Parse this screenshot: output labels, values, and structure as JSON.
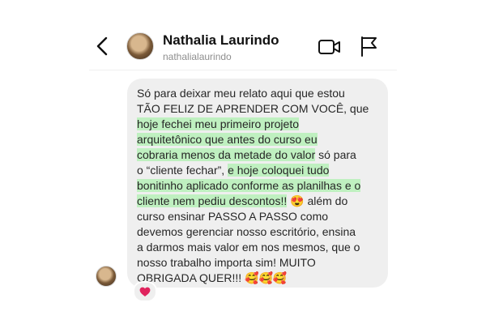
{
  "header": {
    "name": "Nathalia Laurindo",
    "username": "nathalialaurindo"
  },
  "icons": {
    "back": "chevron-left-icon",
    "video": "video-camera-icon",
    "flag": "flag-icon",
    "reaction": "heart-icon"
  },
  "colors": {
    "highlight": "#bff0c0",
    "bubble": "#efefef",
    "heart": "#e0245e"
  },
  "message": {
    "lines": [
      {
        "segments": [
          {
            "text": "Só para deixar meu relato aqui que estou"
          }
        ]
      },
      {
        "segments": [
          {
            "text": "TÃO FELIZ DE APRENDER COM VOCÊ, que"
          }
        ]
      },
      {
        "segments": [
          {
            "text": "hoje fechei meu primeiro projeto",
            "hl": true
          }
        ]
      },
      {
        "segments": [
          {
            "text": "arquitetônico que antes do curso eu",
            "hl": true
          }
        ]
      },
      {
        "segments": [
          {
            "text": "cobraria menos da metade do valor",
            "hl": true
          },
          {
            "text": " só para"
          }
        ]
      },
      {
        "segments": [
          {
            "text": "o “cliente fechar”, "
          },
          {
            "text": "e hoje coloquei tudo",
            "hl": true
          }
        ]
      },
      {
        "segments": [
          {
            "text": "bonitinho aplicado conforme as planilhas e o",
            "hl": true
          }
        ]
      },
      {
        "segments": [
          {
            "text": "cliente nem pediu descontos!!",
            "hl": true
          },
          {
            "text": " 😍 além do"
          }
        ]
      },
      {
        "segments": [
          {
            "text": "curso ensinar PASSO A PASSO como"
          }
        ]
      },
      {
        "segments": [
          {
            "text": "devemos gerenciar nosso escritório, ensina"
          }
        ]
      },
      {
        "segments": [
          {
            "text": "a darmos mais valor em nos mesmos, que o"
          }
        ]
      },
      {
        "segments": [
          {
            "text": "nosso trabalho importa sim! MUITO"
          }
        ]
      },
      {
        "segments": [
          {
            "text": "OBRIGADA QUER!!! 🥰🥰🥰"
          }
        ]
      }
    ]
  },
  "reaction": "❤️"
}
